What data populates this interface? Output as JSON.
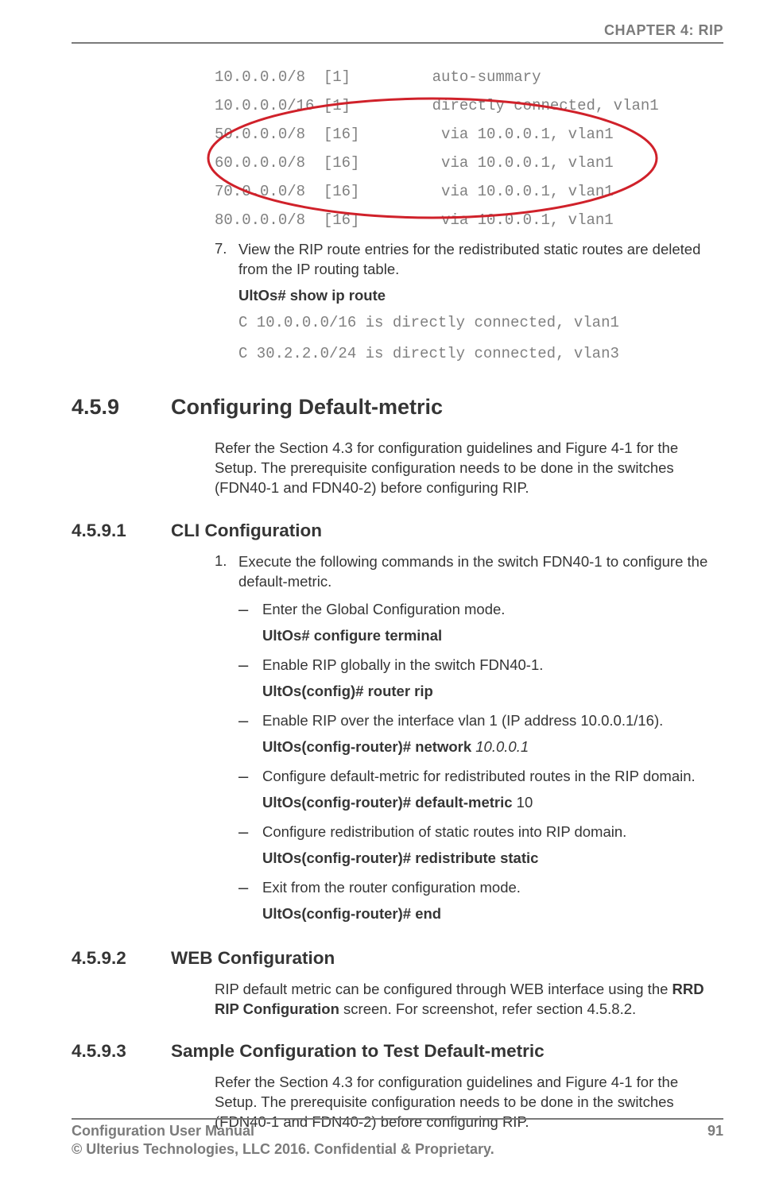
{
  "header": {
    "chapter": "CHAPTER 4: RIP"
  },
  "routing_table": {
    "rows": [
      {
        "net": "10.0.0.0/8",
        "metric": "[1]",
        "info": "auto-summary"
      },
      {
        "net": "10.0.0.0/16",
        "metric": "[1]",
        "info": "directly connected, vlan1"
      },
      {
        "net": "50.0.0.0/8",
        "metric": "[16]",
        "info": " via 10.0.0.1, vlan1"
      },
      {
        "net": "60.0.0.0/8",
        "metric": "[16]",
        "info": " via 10.0.0.1, vlan1"
      },
      {
        "net": "70.0.0.0/8",
        "metric": "[16]",
        "info": " via 10.0.0.1, vlan1"
      },
      {
        "net": "80.0.0.0/8",
        "metric": "[16]",
        "info": " via 10.0.0.1, vlan1"
      }
    ]
  },
  "step7": {
    "num": "7.",
    "text": "View the RIP route entries for the redistributed static routes are deleted from the IP routing table.",
    "cmd": "UltOs# show ip route",
    "out1": "C 10.0.0.0/16 is directly connected, vlan1",
    "out2": "C 30.2.2.0/24 is directly connected, vlan3"
  },
  "s459": {
    "num": "4.5.9",
    "title": "Configuring Default-metric",
    "intro": "Refer the Section 4.3 for configuration guidelines and Figure 4-1 for the Setup. The prerequisite configuration needs to be done in the switches (FDN40-1 and FDN40-2) before configuring RIP."
  },
  "s4591": {
    "num": "4.5.9.1",
    "title": "CLI Configuration",
    "step1": {
      "num": "1.",
      "text": "Execute the following commands in the switch FDN40-1 to configure the default-metric.",
      "subs": [
        {
          "desc": "Enter the Global Configuration mode.",
          "cmd": "UltOs# configure terminal"
        },
        {
          "desc": "Enable RIP globally in the switch FDN40-1.",
          "cmd": "UltOs(config)# router rip"
        },
        {
          "desc": "Enable RIP over the interface vlan 1 (IP address 10.0.0.1/16).",
          "cmd_prefix": "UltOs(config-router)# network ",
          "cmd_arg": "10.0.0.1"
        },
        {
          "desc": "Configure default-metric for redistributed routes in the RIP domain.",
          "cmd_prefix": "UltOs(config-router)# default-metric ",
          "cmd_arg_plain": "10"
        },
        {
          "desc": "Configure redistribution of static routes into RIP domain.",
          "cmd": "UltOs(config-router)# redistribute static"
        },
        {
          "desc": "Exit from the router configuration mode.",
          "cmd": "UltOs(config-router)# end"
        }
      ]
    }
  },
  "s4592": {
    "num": "4.5.9.2",
    "title": "WEB Configuration",
    "text_prefix": "RIP default metric can be configured through WEB interface using the ",
    "text_bold": "RRD RIP Configuration",
    "text_suffix": " screen. For screenshot, refer section 4.5.8.2."
  },
  "s4593": {
    "num": "4.5.9.3",
    "title": "Sample Configuration to Test Default-metric",
    "text": "Refer the Section 4.3 for configuration guidelines and Figure 4-1 for the Setup. The prerequisite configuration needs to be done in the switches (FDN40-1 and FDN40-2) before configuring RIP."
  },
  "footer": {
    "left": "Configuration User Manual",
    "right": "91",
    "line2": "© Ulterius Technologies, LLC 2016. Confidential & Proprietary."
  }
}
